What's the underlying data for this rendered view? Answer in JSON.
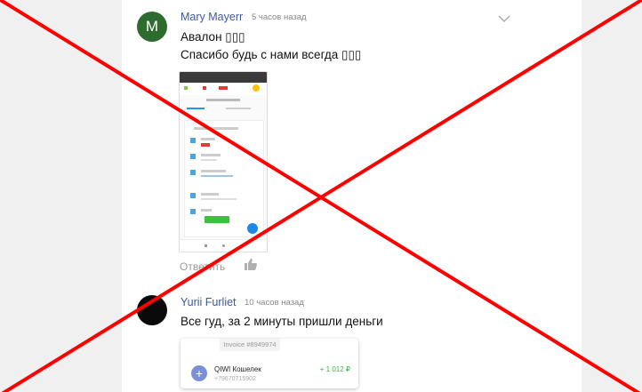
{
  "comments": [
    {
      "avatar_letter": "M",
      "author": "Mary Mayerr",
      "time": "5 часов назад",
      "lines": [
        "Авалон ▯▯▯",
        "Спасибо будь с нами всегда ▯▯▯"
      ],
      "reply_label": "Ответить"
    },
    {
      "avatar_letter": "",
      "author": "Yurii Furliet",
      "time": "10 часов назад",
      "lines": [
        "Все гуд, за 2 минуты пришли деньги"
      ],
      "receipt": {
        "invoice": "Invoice #8949974",
        "wallet": "QIWI Кошелек",
        "phone": "+79670715902",
        "amount": "+ 1 012 ₽"
      }
    }
  ],
  "colors": {
    "avatar_green": "#2e6b2e",
    "avatar_black": "#0a0a0a",
    "cross_red": "#ff0000",
    "author_blue": "#3d5a99"
  }
}
